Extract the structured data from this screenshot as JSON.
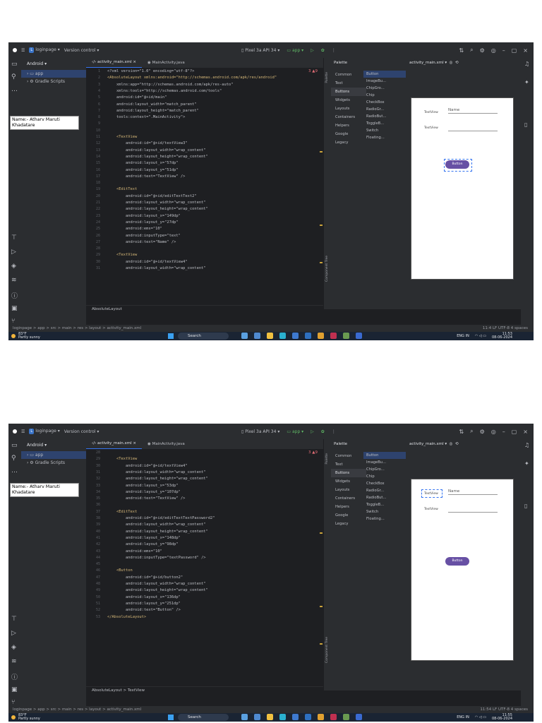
{
  "shots": [
    {
      "titlebar": {
        "project": "loginpage",
        "project_badge": "L",
        "vcs": "Version control",
        "device": "Pixel 3a API 34",
        "run_config": "app"
      },
      "project_panel": {
        "title": "Android",
        "items": [
          "app",
          "Gradle Scripts"
        ],
        "selected": 0
      },
      "name_note": "Name:- Atharv Maruti Khadatare",
      "tabs": [
        "activity_main.xml",
        "MainActivity.java"
      ],
      "warnings": "3 ▲9",
      "code": [
        {
          "n": "1",
          "t": "<?xml version=\"1.0\" encoding=\"utf-8\"?>"
        },
        {
          "n": "2",
          "t": "<AbsoluteLayout xmlns:android=\"http://schemas.android.com/apk/res/android\""
        },
        {
          "n": "3",
          "t": "    xmlns:app=\"http://schemas.android.com/apk/res-auto\""
        },
        {
          "n": "4",
          "t": "    xmlns:tools=\"http://schemas.android.com/tools\""
        },
        {
          "n": "5",
          "t": "    android:id=\"@+id/main\""
        },
        {
          "n": "6",
          "t": "    android:layout_width=\"match_parent\""
        },
        {
          "n": "7",
          "t": "    android:layout_height=\"match_parent\""
        },
        {
          "n": "8",
          "t": "    tools:context=\".MainActivity\">"
        },
        {
          "n": "9",
          "t": ""
        },
        {
          "n": "10",
          "t": ""
        },
        {
          "n": "11",
          "t": "    <TextView"
        },
        {
          "n": "12",
          "t": "        android:id=\"@+id/textView3\""
        },
        {
          "n": "13",
          "t": "        android:layout_width=\"wrap_content\""
        },
        {
          "n": "14",
          "t": "        android:layout_height=\"wrap_content\""
        },
        {
          "n": "15",
          "t": "        android:layout_x=\"57dp\""
        },
        {
          "n": "16",
          "t": "        android:layout_y=\"51dp\""
        },
        {
          "n": "17",
          "t": "        android:text=\"TextView\" />"
        },
        {
          "n": "18",
          "t": ""
        },
        {
          "n": "19",
          "t": "    <EditText"
        },
        {
          "n": "20",
          "t": "        android:id=\"@+id/editTextText2\""
        },
        {
          "n": "21",
          "t": "        android:layout_width=\"wrap_content\""
        },
        {
          "n": "22",
          "t": "        android:layout_height=\"wrap_content\""
        },
        {
          "n": "23",
          "t": "        android:layout_x=\"149dp\""
        },
        {
          "n": "24",
          "t": "        android:layout_y=\"27dp\""
        },
        {
          "n": "25",
          "t": "        android:ems=\"10\""
        },
        {
          "n": "26",
          "t": "        android:inputType=\"text\""
        },
        {
          "n": "27",
          "t": "        android:text=\"Name\" />"
        },
        {
          "n": "28",
          "t": ""
        },
        {
          "n": "29",
          "t": "    <TextView"
        },
        {
          "n": "30",
          "t": "        android:id=\"@+id/textView4\""
        },
        {
          "n": "31",
          "t": "        android:layout_width=\"wrap_content\""
        }
      ],
      "editor_breadcrumb": "AbsoluteLayout",
      "palette": {
        "title": "Palette",
        "categories": [
          "Common",
          "Text",
          "Buttons",
          "Widgets",
          "Layouts",
          "Containers",
          "Helpers",
          "Google",
          "Legacy"
        ],
        "selected_category": 2,
        "widgets": [
          "Button",
          "ImageBu...",
          "ChipGro...",
          "Chip",
          "CheckBox",
          "RadioGr...",
          "RadioBut...",
          "ToggleB...",
          "Switch",
          "Floating..."
        ],
        "selected_widget": 0
      },
      "component_tree": "Component Tree",
      "design": {
        "title": "activity_main.xml",
        "tv1": "TextView",
        "tv2": "TextView",
        "edit_name": "Name",
        "button": "Button"
      },
      "status": {
        "path": "loginpage > app > src > main > res > layout > activity_main.xml",
        "right": "11:4  LF  UTF-8  4 spaces"
      },
      "taskbar": {
        "temp": "83°F",
        "weather": "Partly sunny",
        "search": "Search",
        "lang": "ENG IN",
        "time": "11:53",
        "date": "08-06-2024"
      }
    },
    {
      "titlebar": {
        "project": "loginpage",
        "project_badge": "L",
        "vcs": "Version control",
        "device": "Pixel 3a API 34",
        "run_config": "app"
      },
      "project_panel": {
        "title": "Android",
        "items": [
          "app",
          "Gradle Scripts"
        ],
        "selected": 0
      },
      "name_note": "Name:- Atharv Maruti Khadatare",
      "tabs": [
        "activity_main.xml",
        "MainActivity.java"
      ],
      "warnings": "3 ▲9",
      "code": [
        {
          "n": "28",
          "t": ""
        },
        {
          "n": "29",
          "t": "    <TextView"
        },
        {
          "n": "30",
          "t": "        android:id=\"@+id/textView4\""
        },
        {
          "n": "31",
          "t": "        android:layout_width=\"wrap_content\""
        },
        {
          "n": "32",
          "t": "        android:layout_height=\"wrap_content\""
        },
        {
          "n": "33",
          "t": "        android:layout_x=\"53dp\""
        },
        {
          "n": "34",
          "t": "        android:layout_y=\"107dp\""
        },
        {
          "n": "35",
          "t": "        android:text=\"TextView\" />"
        },
        {
          "n": "36",
          "t": ""
        },
        {
          "n": "37",
          "t": "    <EditText"
        },
        {
          "n": "38",
          "t": "        android:id=\"@+id/editTextTextPassword2\""
        },
        {
          "n": "39",
          "t": "        android:layout_width=\"wrap_content\""
        },
        {
          "n": "40",
          "t": "        android:layout_height=\"wrap_content\""
        },
        {
          "n": "41",
          "t": "        android:layout_x=\"148dp\""
        },
        {
          "n": "42",
          "t": "        android:layout_y=\"98dp\""
        },
        {
          "n": "43",
          "t": "        android:ems=\"10\""
        },
        {
          "n": "44",
          "t": "        android:inputType=\"textPassword\" />"
        },
        {
          "n": "45",
          "t": ""
        },
        {
          "n": "46",
          "t": "    <Button"
        },
        {
          "n": "47",
          "t": "        android:id=\"@+id/button2\""
        },
        {
          "n": "48",
          "t": "        android:layout_width=\"wrap_content\""
        },
        {
          "n": "49",
          "t": "        android:layout_height=\"wrap_content\""
        },
        {
          "n": "50",
          "t": "        android:layout_x=\"136dp\""
        },
        {
          "n": "51",
          "t": "        android:layout_y=\"251dp\""
        },
        {
          "n": "52",
          "t": "        android:text=\"Button\" />"
        },
        {
          "n": "53",
          "t": "</AbsoluteLayout>"
        }
      ],
      "editor_breadcrumb": "AbsoluteLayout  >  TextView",
      "palette": {
        "title": "Palette",
        "categories": [
          "Common",
          "Text",
          "Buttons",
          "Widgets",
          "Layouts",
          "Containers",
          "Helpers",
          "Google",
          "Legacy"
        ],
        "selected_category": 2,
        "widgets": [
          "Button",
          "ImageBu...",
          "ChipGro...",
          "Chip",
          "CheckBox",
          "RadioGr...",
          "RadioBut...",
          "ToggleB...",
          "Switch",
          "Floating..."
        ],
        "selected_widget": 0
      },
      "component_tree": "Component Tree",
      "design": {
        "title": "activity_main.xml",
        "tv1": "TextView",
        "tv2": "TextView",
        "edit_name": "Name",
        "button": "Button"
      },
      "status": {
        "path": "loginpage > app > src > main > res > layout > activity_main.xml",
        "right": "11:54  LF  UTF-8  4 spaces"
      },
      "taskbar": {
        "temp": "83°F",
        "weather": "Partly sunny",
        "search": "Search",
        "lang": "ENG IN",
        "time": "11:55",
        "date": "08-06-2024"
      }
    }
  ],
  "icons": [
    "android-studio-icon",
    "hamburger-menu-icon",
    "folder-icon",
    "run-icon",
    "debug-icon",
    "search-icon",
    "settings-icon",
    "account-icon",
    "minimize-icon",
    "maximize-icon",
    "close-icon",
    "windows-start-icon",
    "weather-icon"
  ],
  "colors": {
    "ide_bg": "#1e1f22",
    "panel_bg": "#2b2d30",
    "accent": "#3574f0",
    "button_purple": "#6750a4",
    "xml_tag": "#d5b778",
    "xml_value": "#6aab73"
  }
}
